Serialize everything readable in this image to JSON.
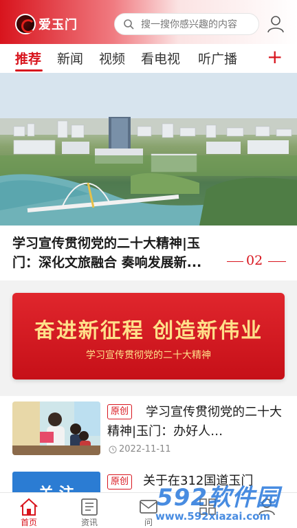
{
  "app": {
    "name": "爱玉门"
  },
  "search": {
    "placeholder": "搜一搜你感兴趣的内容"
  },
  "tabs": [
    "推荐",
    "新闻",
    "视频",
    "看电视",
    "听广播"
  ],
  "active_tab": "推荐",
  "headline": {
    "title": "学习宣传贯彻党的二十大精神|玉门：深化文旅融合 奏响发展新...",
    "page": "02"
  },
  "banner": {
    "title": "奋进新征程 创造新伟业",
    "subtitle": "学习宣传贯彻党的二十大精神"
  },
  "news": [
    {
      "tag": "原创",
      "title": "学习宣传贯彻党的二十大精神|玉门：办好人…",
      "date": "2022-11-11"
    },
    {
      "tag": "原创",
      "title": "关于在312国道玉门"
    }
  ],
  "follow_card": {
    "label": "关 注"
  },
  "bottom_nav": [
    {
      "label": "首页",
      "icon": "home-icon",
      "active": true
    },
    {
      "label": "资讯",
      "icon": "news-icon",
      "active": false
    },
    {
      "label": "问",
      "icon": "mail-icon",
      "active": false
    },
    {
      "label": "",
      "icon": "grid-icon",
      "active": false
    },
    {
      "label": "",
      "icon": "user-icon",
      "active": false
    }
  ],
  "watermark": {
    "brand": "592软件园",
    "url": "www.592xiazai.com"
  },
  "colors": {
    "accent": "#d8141d",
    "banner_text": "#ffe08a",
    "watermark": "#2878dc"
  }
}
